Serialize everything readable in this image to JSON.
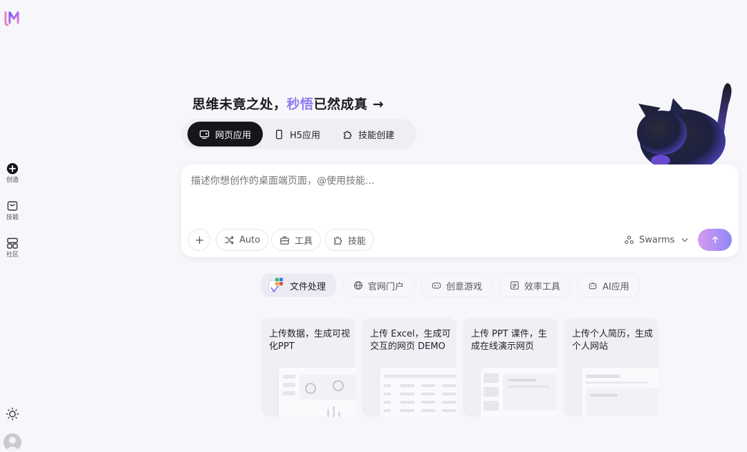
{
  "sidebar": {
    "items": [
      {
        "label": "创造",
        "icon": "plus-circle-icon"
      },
      {
        "label": "技能",
        "icon": "bag-icon"
      },
      {
        "label": "社区",
        "icon": "grid-icon"
      }
    ]
  },
  "headline": {
    "part1": "思维未竟之处，",
    "accent": "秒悟",
    "part2": "已然成真 →"
  },
  "mode_tabs": [
    {
      "label": "网页应用",
      "icon": "monitor-icon",
      "active": true
    },
    {
      "label": "H5应用",
      "icon": "phone-icon",
      "active": false
    },
    {
      "label": "技能创建",
      "icon": "puzzle-icon",
      "active": false
    }
  ],
  "prompt": {
    "placeholder": "描述你想创作的桌面端页面，@使用技能...",
    "buttons": {
      "auto": "Auto",
      "tools": "工具",
      "skills": "技能"
    },
    "swarms": "Swarms"
  },
  "categories": [
    {
      "label": "文件处理",
      "active": true
    },
    {
      "label": "官网门户",
      "icon": "globe-icon"
    },
    {
      "label": "创意游戏",
      "icon": "gamepad-icon"
    },
    {
      "label": "效率工具",
      "icon": "list-icon"
    },
    {
      "label": "AI应用",
      "icon": "robot-icon"
    }
  ],
  "cards": [
    {
      "title": "上传数据，生成可视化PPT"
    },
    {
      "title": "上传 Excel，生成可交互的网页 DEMO"
    },
    {
      "title": "上传 PPT 课件，生成在线演示网页"
    },
    {
      "title": "上传个人简历，生成个人网站"
    }
  ],
  "colors": {
    "accent": "#8c7cf0",
    "dark_tab": "#14161c"
  }
}
